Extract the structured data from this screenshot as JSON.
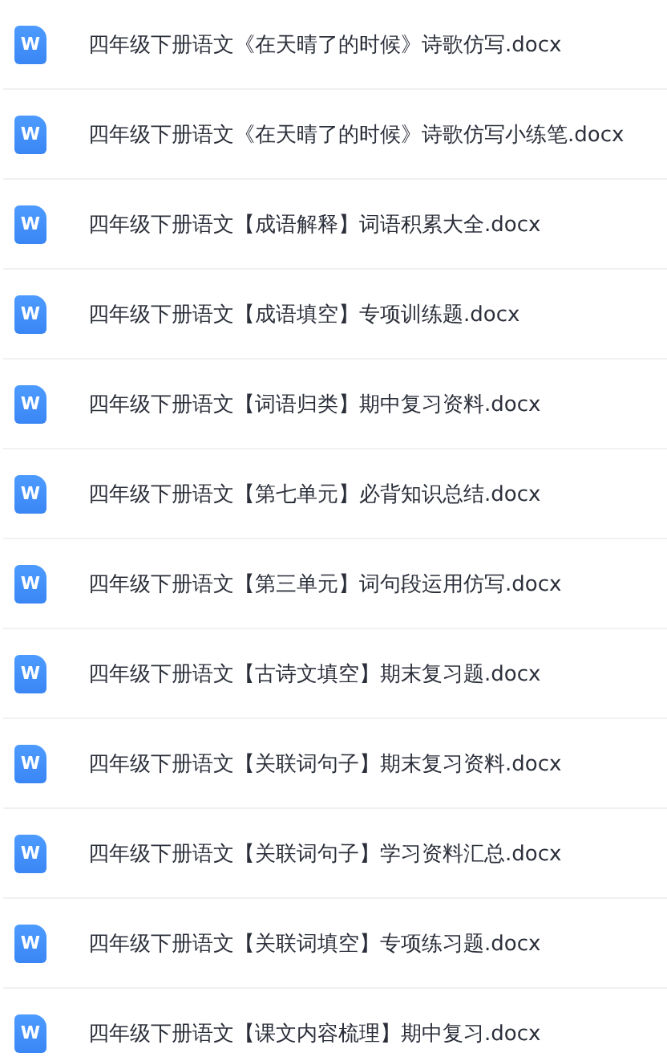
{
  "files": [
    {
      "badge": "W",
      "name": "四年级下册语文《在天晴了的时候》诗歌仿写.docx"
    },
    {
      "badge": "W",
      "name": "四年级下册语文《在天晴了的时候》诗歌仿写小练笔.docx"
    },
    {
      "badge": "W",
      "name": "四年级下册语文【成语解释】词语积累大全.docx"
    },
    {
      "badge": "W",
      "name": "四年级下册语文【成语填空】专项训练题.docx"
    },
    {
      "badge": "W",
      "name": "四年级下册语文【词语归类】期中复习资料.docx"
    },
    {
      "badge": "W",
      "name": "四年级下册语文【第七单元】必背知识总结.docx"
    },
    {
      "badge": "W",
      "name": "四年级下册语文【第三单元】词句段运用仿写.docx"
    },
    {
      "badge": "W",
      "name": "四年级下册语文【古诗文填空】期末复习题.docx"
    },
    {
      "badge": "W",
      "name": "四年级下册语文【关联词句子】期末复习资料.docx"
    },
    {
      "badge": "W",
      "name": "四年级下册语文【关联词句子】学习资料汇总.docx"
    },
    {
      "badge": "W",
      "name": "四年级下册语文【关联词填空】专项练习题.docx"
    },
    {
      "badge": "W",
      "name": "四年级下册语文【课文内容梳理】期中复习.docx"
    }
  ]
}
